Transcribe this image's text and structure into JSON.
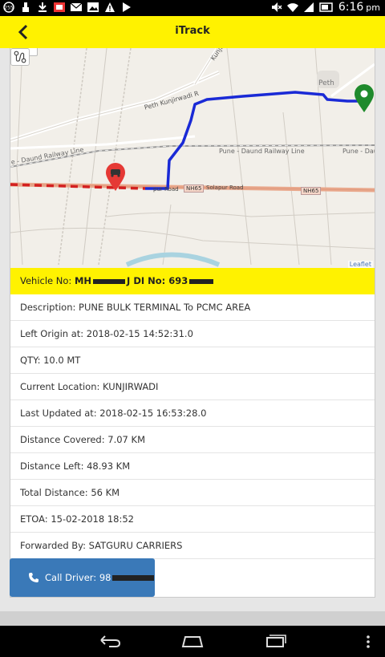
{
  "status_bar": {
    "time": "6:16",
    "ampm": "pm",
    "icons": [
      "cast-icon",
      "usb-icon",
      "download-icon",
      "gallery-icon",
      "mail-icon",
      "image-icon",
      "warning-icon",
      "play-icon",
      "mute-icon",
      "wifi-icon",
      "signal-icon",
      "battery-icon"
    ]
  },
  "app_bar": {
    "title": "iTrack"
  },
  "map": {
    "zoom_label": "-",
    "labels": {
      "peth_kunjirwadi": "Peth Kunjirwadi R",
      "kunjirwadi": "Kunjirwa",
      "peth": "Peth",
      "railway_right": "Pune - Daund Railway Line",
      "railway_right2": "Pune - Dau",
      "railway_left": "e - Daund Railway Line",
      "solapur": "Solapur Road",
      "solapur_left": "pur Road",
      "nh65_a": "NH65",
      "nh65_b": "NH65"
    },
    "attribution": "Leaflet",
    "colors": {
      "route": "#1a2ad6",
      "origin_marker": "#e53935",
      "destination_marker": "#1f8a2c",
      "road": "#e9a88c"
    }
  },
  "details": {
    "vehicle_prefix": "Vehicle No: ",
    "vehicle_visible": "MH",
    "vehicle_mid": "J DI No: 693",
    "rows": [
      "Description: PUNE BULK TERMINAL To PCMC AREA",
      "Left Origin at: 2018-02-15 14:52:31.0",
      "QTY: 10.0 MT",
      "Current Location: KUNJIRWADI",
      "Last Updated at: 2018-02-15 16:53:28.0",
      "Distance Covered: 7.07 KM",
      "Distance Left: 48.93 KM",
      "Total Distance: 56 KM",
      "ETOA: 15-02-2018 18:52",
      "Forwarded By: SATGURU CARRIERS"
    ]
  },
  "call_button": {
    "label": "Call Driver: 98"
  },
  "nav_bar": {
    "icons": [
      "back-icon",
      "home-icon",
      "recents-icon",
      "menu-icon"
    ]
  }
}
